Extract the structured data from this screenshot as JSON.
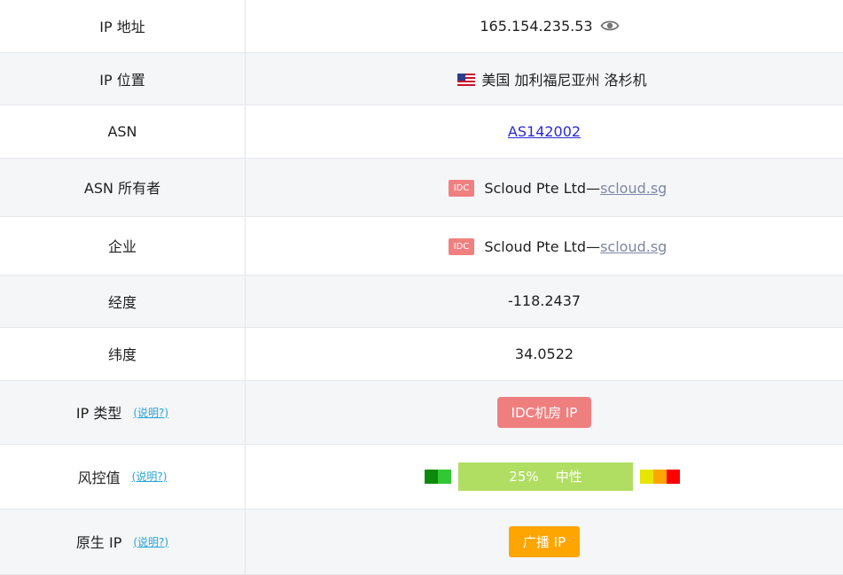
{
  "rows": {
    "ip_address": {
      "label": "IP 地址",
      "value": "165.154.235.53",
      "icon": "eye-icon"
    },
    "ip_location": {
      "label": "IP 位置",
      "flag": "us-flag-icon",
      "value": "美国 加利福尼亚州 洛杉机"
    },
    "asn": {
      "label": "ASN",
      "value": "AS142002"
    },
    "asn_owner": {
      "label": "ASN 所有者",
      "tag": "IDC",
      "name": "Scloud Pte Ltd—",
      "link": "scloud.sg"
    },
    "enterprise": {
      "label": "企业",
      "tag": "IDC",
      "name": "Scloud Pte Ltd—",
      "link": "scloud.sg"
    },
    "longitude": {
      "label": "经度",
      "value": "-118.2437"
    },
    "latitude": {
      "label": "纬度",
      "value": "34.0522"
    },
    "ip_type": {
      "label": "IP 类型",
      "help": "(说明?)",
      "badge": "IDC机房 IP",
      "badge_color": "#ef7f7f"
    },
    "risk": {
      "label": "风控值",
      "help": "(说明?)",
      "percent": "25%",
      "level": "中性",
      "bar_color": "#b0de62",
      "left_colors": [
        "#0b8a0b",
        "#32c832"
      ],
      "right_colors": [
        "#e6e600",
        "#ffa500",
        "#ff0000"
      ]
    },
    "native_ip": {
      "label": "原生 IP",
      "help": "(说明?)",
      "badge": "广播 IP",
      "badge_color": "#ffa500"
    }
  }
}
